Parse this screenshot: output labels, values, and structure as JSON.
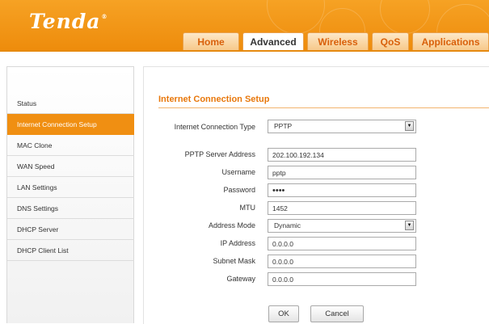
{
  "brand": {
    "logo": "Tenda",
    "registered_mark": "®"
  },
  "tabs": [
    {
      "label": "Home",
      "active": false
    },
    {
      "label": "Advanced",
      "active": true
    },
    {
      "label": "Wireless",
      "active": false
    },
    {
      "label": "QoS",
      "active": false
    },
    {
      "label": "Applications",
      "active": false
    }
  ],
  "sidebar": {
    "items": [
      {
        "label": "Status",
        "active": false
      },
      {
        "label": "Internet Connection Setup",
        "active": true
      },
      {
        "label": "MAC Clone",
        "active": false
      },
      {
        "label": "WAN Speed",
        "active": false
      },
      {
        "label": "LAN Settings",
        "active": false
      },
      {
        "label": "DNS Settings",
        "active": false
      },
      {
        "label": "DHCP Server",
        "active": false
      },
      {
        "label": "DHCP Client List",
        "active": false
      }
    ]
  },
  "form": {
    "title": "Internet Connection Setup",
    "connection_type": {
      "label": "Internet Connection Type",
      "value": "PPTP"
    },
    "server_address": {
      "label": "PPTP Server Address",
      "value": "202.100.192.134"
    },
    "username": {
      "label": "Username",
      "value": "pptp"
    },
    "password": {
      "label": "Password",
      "value": "pptp"
    },
    "mtu": {
      "label": "MTU",
      "value": "1452"
    },
    "address_mode": {
      "label": "Address Mode",
      "value": "Dynamic"
    },
    "ip_address": {
      "label": "IP Address",
      "value": "0.0.0.0"
    },
    "subnet_mask": {
      "label": "Subnet Mask",
      "value": "0.0.0.0"
    },
    "gateway": {
      "label": "Gateway",
      "value": "0.0.0.0"
    },
    "ok_label": "OK",
    "cancel_label": "Cancel"
  },
  "colors": {
    "header_orange": "#f39a1c",
    "accent": "#e8780c",
    "active_sidebar": "#f08f12"
  },
  "icons": {
    "dropdown": "chevron-down-icon"
  }
}
